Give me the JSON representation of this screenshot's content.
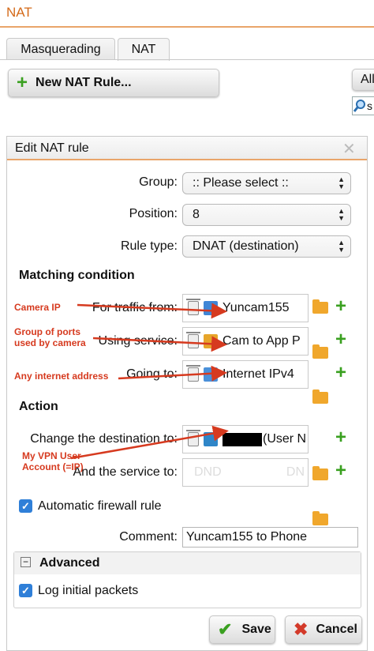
{
  "header": {
    "title": "NAT"
  },
  "tabs": [
    {
      "label": "Masquerading"
    },
    {
      "label": "NAT"
    }
  ],
  "toolbar": {
    "new_rule_label": "New NAT Rule...",
    "partial_button_label": "All",
    "partial_search_label": "s"
  },
  "dialog": {
    "title": "Edit NAT rule",
    "group": {
      "label": "Group:",
      "value": ":: Please select ::"
    },
    "position": {
      "label": "Position:",
      "value": "8"
    },
    "rule_type": {
      "label": "Rule type:",
      "value": "DNAT (destination)"
    },
    "matching": {
      "heading": "Matching condition",
      "traffic_from": {
        "label": "For traffic from:",
        "value": "Yuncam155"
      },
      "using_service": {
        "label": "Using service:",
        "value": "Cam to App P"
      },
      "going_to": {
        "label": "Going to:",
        "value": "Internet IPv4"
      }
    },
    "action": {
      "heading": "Action",
      "change_destination": {
        "label": "Change the destination to:",
        "value": "(User N"
      },
      "and_service": {
        "label": "And the service to:",
        "placeholder": "DND",
        "placeholder2": "DN"
      }
    },
    "auto_firewall": {
      "label": "Automatic firewall rule",
      "checked": true
    },
    "comment": {
      "label": "Comment:",
      "value": "Yuncam155 to Phone"
    },
    "advanced": {
      "heading": "Advanced",
      "log_initial": {
        "label": "Log initial packets",
        "checked": true
      }
    },
    "buttons": {
      "save": "Save",
      "cancel": "Cancel"
    }
  },
  "annotations": {
    "camera_ip": "Camera IP",
    "group_ports": "Group of ports used by camera",
    "any_internet": "Any internet address",
    "vpn_account": "My VPN User Account (=IP)"
  },
  "colors": {
    "accent_orange": "#d46a1a",
    "annotation_red": "#d63a1f",
    "add_green": "#3aa020",
    "checkbox_blue": "#2f7fd8"
  }
}
